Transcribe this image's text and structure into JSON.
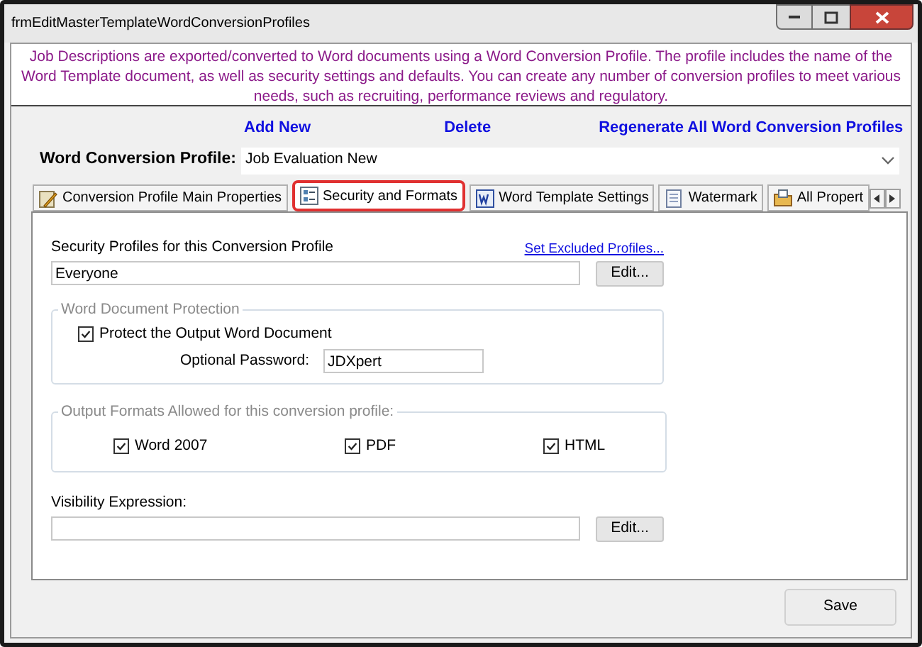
{
  "window": {
    "title": "frmEditMasterTemplateWordConversionProfiles"
  },
  "description": "Job Descriptions are exported/converted to Word documents using a Word Conversion Profile. The profile includes the name of the Word Template document, as well as security settings and defaults.  You can create any number of conversion profiles to meet various needs, such as recruiting, performance reviews and regulatory.",
  "actions": [
    "Add New",
    "Delete",
    "Regenerate All Word Conversion Profiles"
  ],
  "profile": {
    "label": "Word Conversion Profile:",
    "value": "Job Evaluation New"
  },
  "tabs": [
    {
      "label": "Conversion Profile Main Properties",
      "selected": false
    },
    {
      "label": "Security and Formats",
      "selected": true
    },
    {
      "label": "Word Template Settings",
      "selected": false
    },
    {
      "label": "Watermark",
      "selected": false
    },
    {
      "label": "All Propert",
      "selected": false
    }
  ],
  "security": {
    "label": "Security Profiles for this Conversion Profile",
    "link": "Set Excluded Profiles...",
    "value": "Everyone",
    "button": "Edit..."
  },
  "protection": {
    "legend": "Word Document Protection",
    "checkbox": {
      "label": "Protect the Output Word Document",
      "checked": true
    },
    "password_label": "Optional Password:",
    "password": "JDXpert"
  },
  "formats": {
    "legend": "Output Formats Allowed for this conversion profile:",
    "options": [
      {
        "label": "Word 2007",
        "checked": true
      },
      {
        "label": "PDF",
        "checked": true
      },
      {
        "label": "HTML",
        "checked": true
      }
    ]
  },
  "visibility": {
    "label": "Visibility Expression:",
    "button": "Edit..."
  },
  "save": "Save"
}
